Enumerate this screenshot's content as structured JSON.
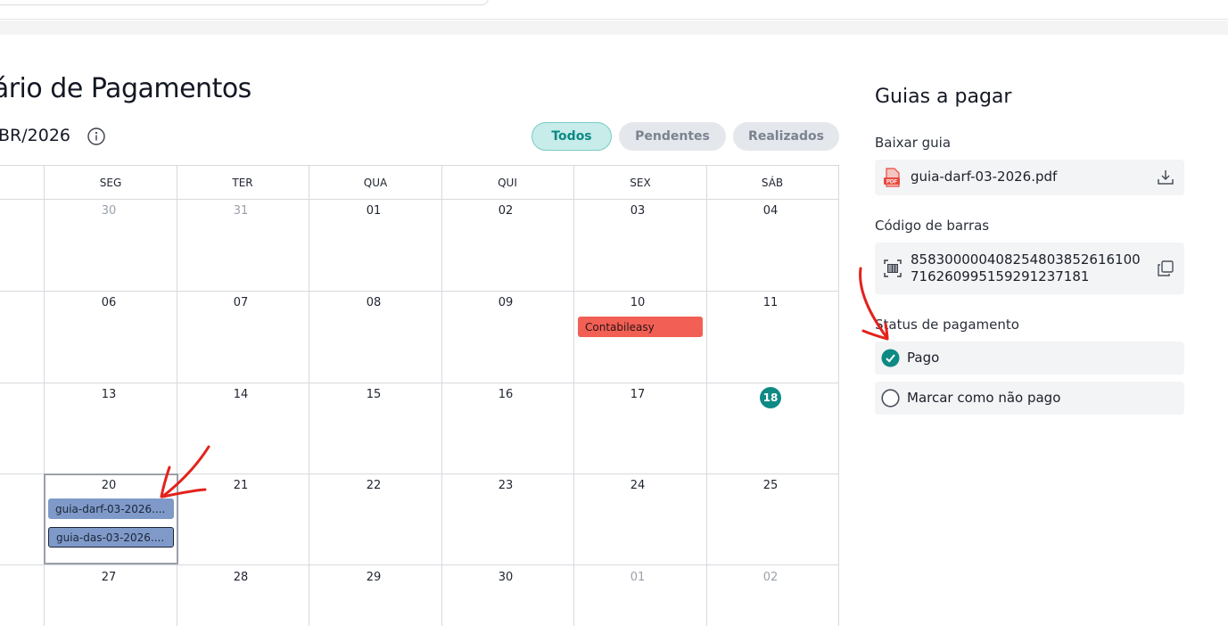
{
  "page": {
    "title": "lário de Pagamentos",
    "month": "BR/2026"
  },
  "filters": [
    {
      "label": "Todos",
      "active": true
    },
    {
      "label": "Pendentes",
      "active": false
    },
    {
      "label": "Realizados",
      "active": false
    }
  ],
  "calendar": {
    "weekdays": [
      "SEG",
      "TER",
      "QUA",
      "QUI",
      "SEX",
      "SÁB"
    ],
    "weeks": [
      [
        "30",
        "31",
        "01",
        "02",
        "03",
        "04"
      ],
      [
        "06",
        "07",
        "08",
        "09",
        "10",
        "11"
      ],
      [
        "13",
        "14",
        "15",
        "16",
        "17",
        "18"
      ],
      [
        "20",
        "21",
        "22",
        "23",
        "24",
        "25"
      ],
      [
        "27",
        "28",
        "29",
        "30",
        "01",
        "02"
      ]
    ],
    "today": "18",
    "events": {
      "contabileasy": "Contabileasy",
      "darf": "guia-darf-03-2026....",
      "das": "guia-das-03-2026...."
    },
    "colors": {
      "accent": "#0e8a84",
      "event_red": "#f25f55",
      "event_blue": "#7f9ac9"
    }
  },
  "sidebar": {
    "title": "Guias a pagar",
    "download": {
      "label": "Baixar guia",
      "file": "guia-darf-03-2026.pdf",
      "pdf_tag": "PDF"
    },
    "barcode": {
      "label": "Código de barras",
      "line1": "85830000040825480385261610 0",
      "line2": "71626099515929123718 1",
      "value_line1": "858300000408254803852616100",
      "value_line2": "716260995159291237181"
    },
    "status": {
      "label": "Status de pagamento",
      "paid": "Pago",
      "unpaid": "Marcar como não pago",
      "selected": "paid"
    }
  },
  "icons": {
    "info": "info-icon",
    "pdf": "pdf-file-icon",
    "download": "download-icon",
    "barcode": "barcode-scan-icon",
    "copy": "copy-icon",
    "check": "check-circle-icon",
    "radio": "radio-empty-icon"
  }
}
